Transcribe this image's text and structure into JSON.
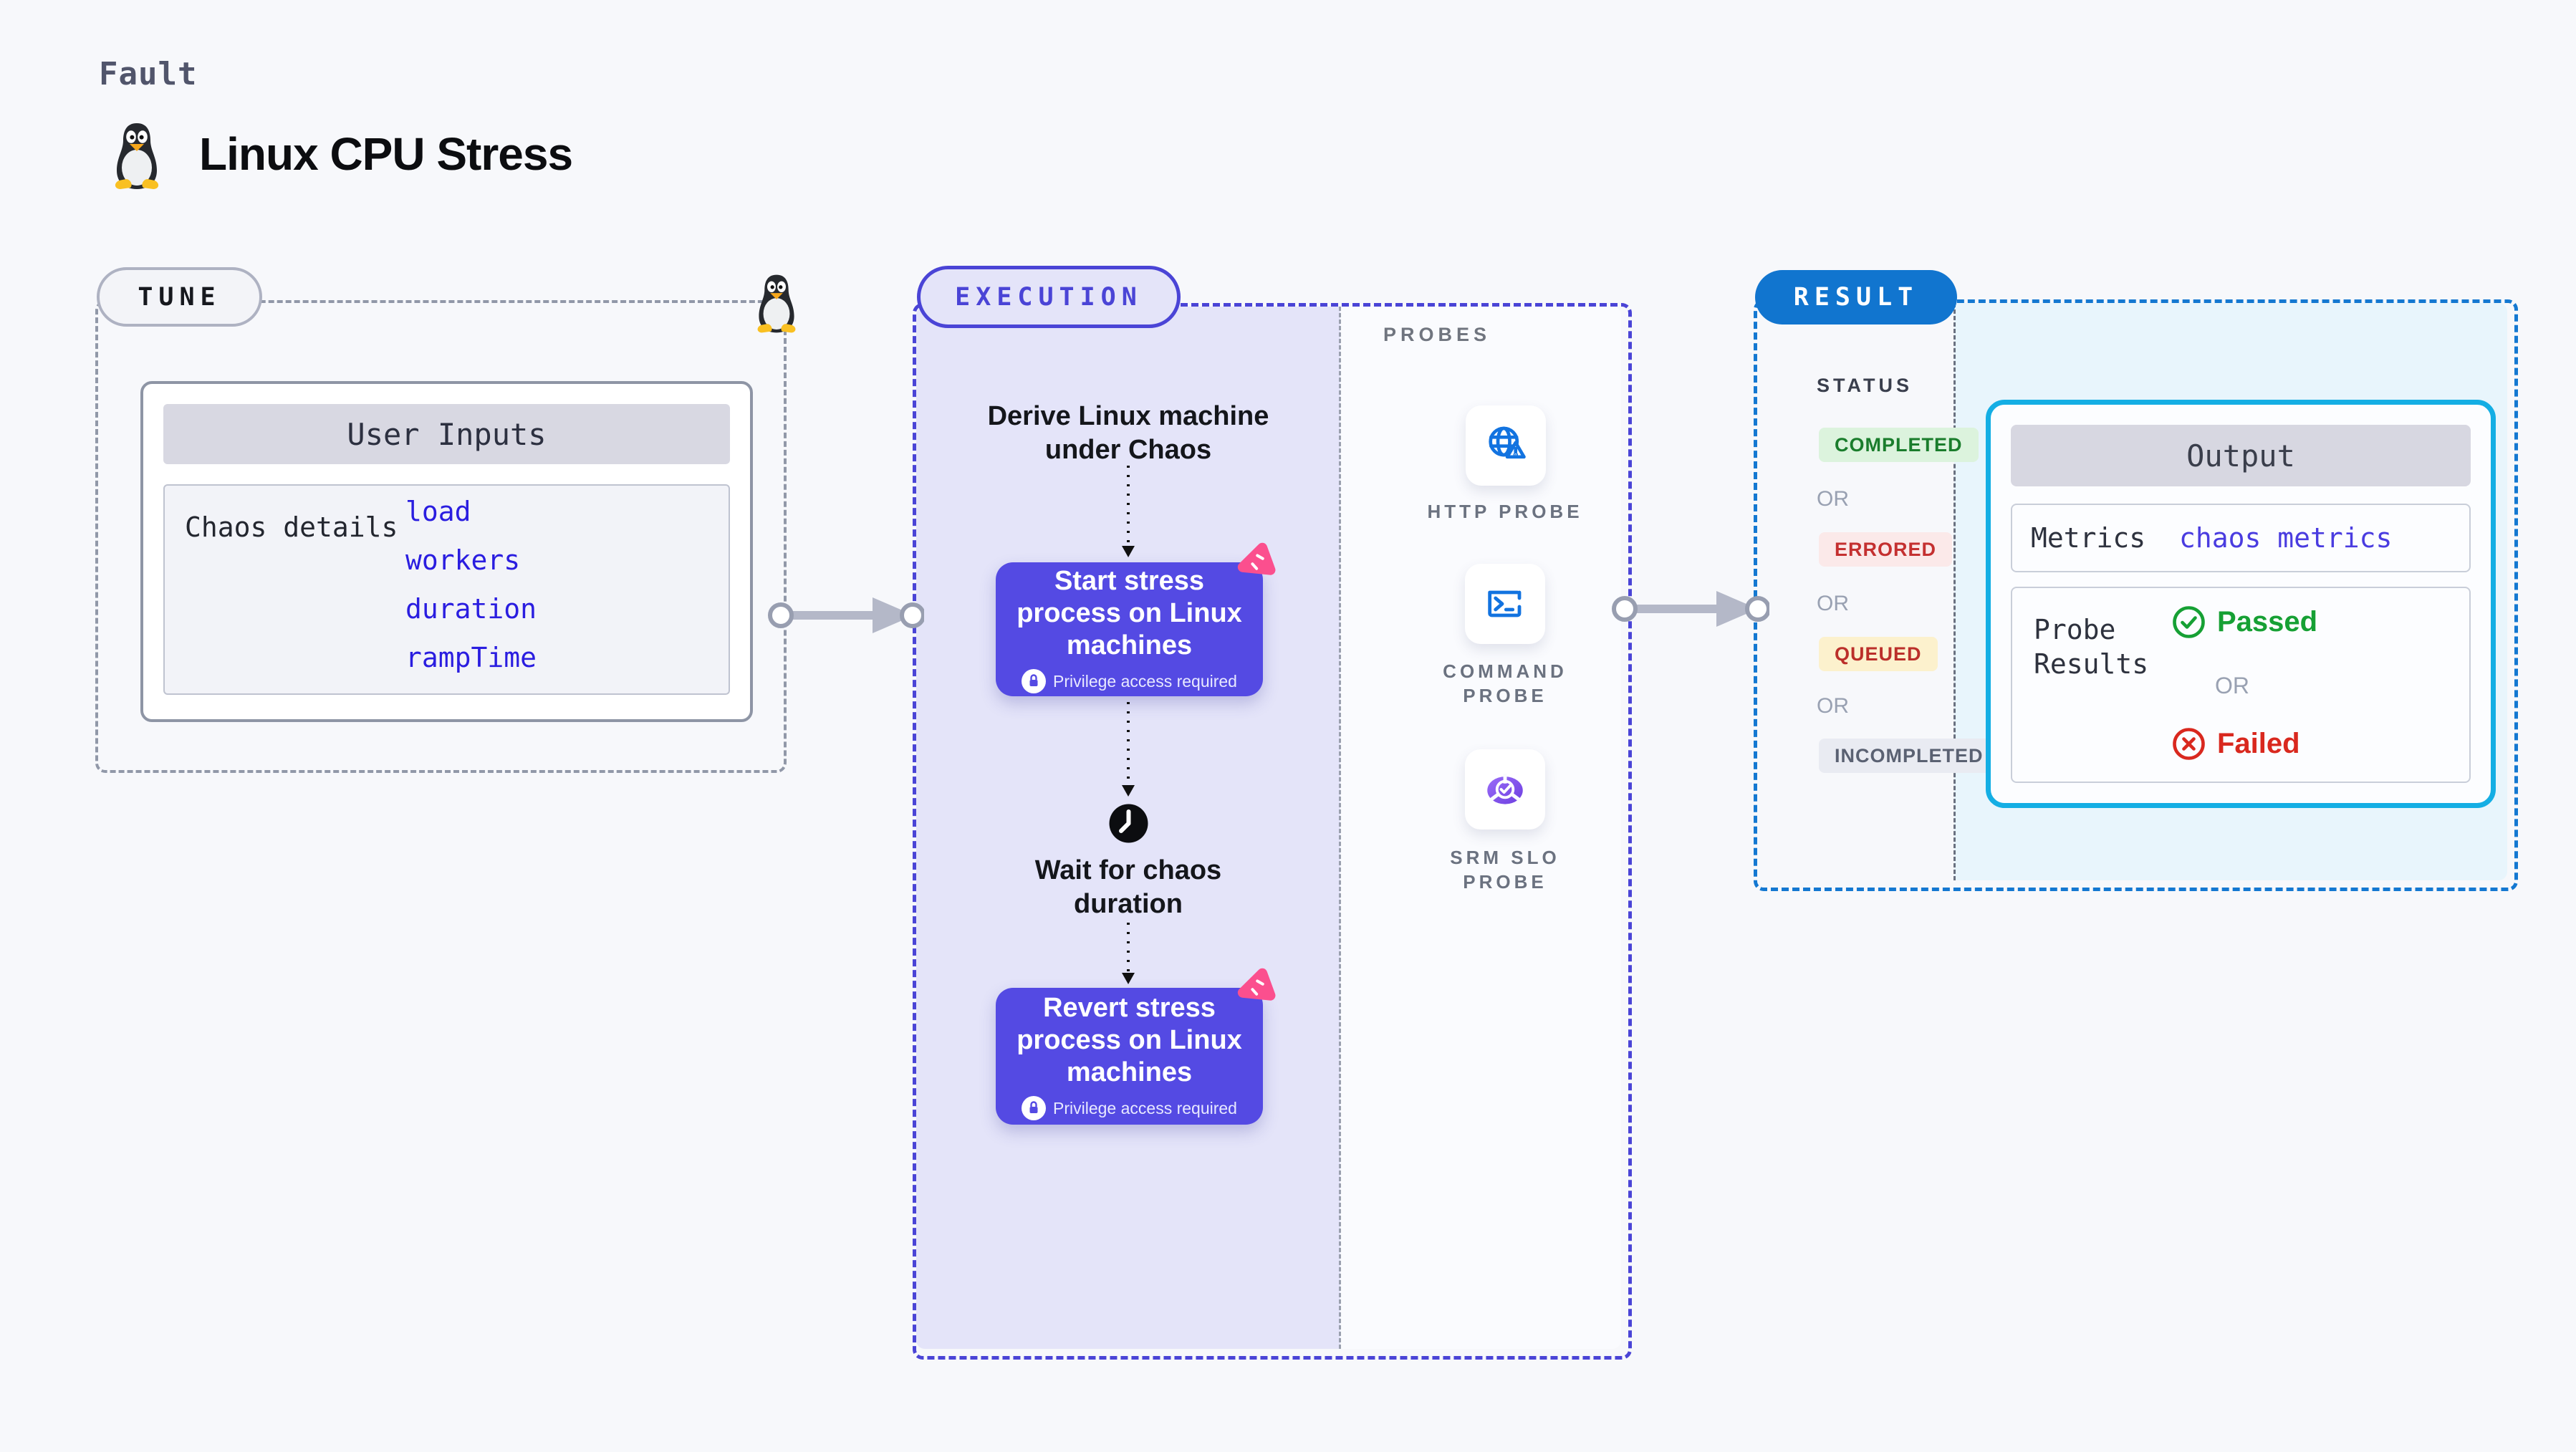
{
  "header": {
    "eyebrow": "Fault",
    "title": "Linux CPU Stress"
  },
  "tune": {
    "badge": "TUNE",
    "card_title": "User Inputs",
    "row_label": "Chaos details",
    "inputs": [
      "load",
      "workers",
      "duration",
      "rampTime"
    ]
  },
  "execution": {
    "badge": "EXECUTION",
    "derive_text": "Derive Linux machine\nunder Chaos",
    "start_step": {
      "title": "Start stress process on Linux machines",
      "note": "Privilege access required"
    },
    "wait_text": "Wait for chaos\nduration",
    "revert_step": {
      "title": "Revert stress process on Linux machines",
      "note": "Privilege access required"
    }
  },
  "probes": {
    "label": "PROBES",
    "items": [
      {
        "label": "HTTP PROBE",
        "icon": "globe-alert-icon"
      },
      {
        "label": "COMMAND\nPROBE",
        "icon": "terminal-icon"
      },
      {
        "label": "SRM SLO\nPROBE",
        "icon": "slo-gauge-icon"
      }
    ]
  },
  "result": {
    "badge": "RESULT",
    "status_label": "STATUS",
    "or_label": "OR",
    "statuses": [
      {
        "label": "COMPLETED",
        "fg": "#1a7d2c",
        "bg": "#dcf3dd"
      },
      {
        "label": "ERRORED",
        "fg": "#c43030",
        "bg": "#fbe9e9"
      },
      {
        "label": "QUEUED",
        "fg": "#bb2f2a",
        "bg": "#fcf1cd"
      },
      {
        "label": "INCOMPLETED",
        "fg": "#5a6172",
        "bg": "#e9ebf2"
      }
    ],
    "output": {
      "title": "Output",
      "metrics_label": "Metrics",
      "metrics_value": "chaos metrics",
      "probe_results_label": "Probe Results",
      "passed_label": "Passed",
      "failed_label": "Failed"
    }
  },
  "colors": {
    "accent_indigo": "#4a44d6",
    "accent_blue": "#1175cf",
    "accent_cyan": "#14aee4",
    "button_purple": "#544ae3",
    "link_blue": "#2a1de0",
    "chaos_pink": "#fb4f8e",
    "icon_blue": "#1273e0",
    "passed_green": "#16a034",
    "failed_red": "#d9281e"
  }
}
